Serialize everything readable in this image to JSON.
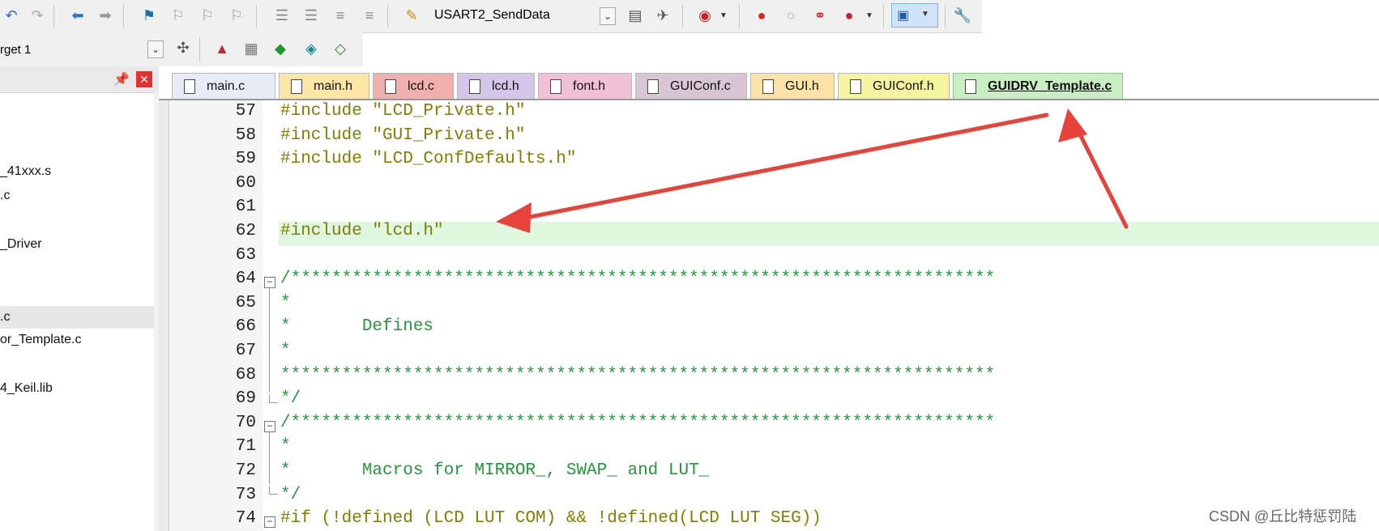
{
  "toolbar": {
    "target_function": "USART2_SendData",
    "build_target": "rget 1"
  },
  "project_panel": {
    "items": [
      "_41xxx.s",
      ".c",
      "_Driver",
      ".c",
      "or_Template.c",
      "4_Keil.lib"
    ]
  },
  "tabs": [
    {
      "label": "main.c",
      "color": "#e8ecf7"
    },
    {
      "label": "main.h",
      "color": "#fbe6a6"
    },
    {
      "label": "lcd.c",
      "color": "#f1b0ae"
    },
    {
      "label": "lcd.h",
      "color": "#d4c6e8"
    },
    {
      "label": "font.h",
      "color": "#f3c1d6"
    },
    {
      "label": "GUIConf.c",
      "color": "#d8c7d2"
    },
    {
      "label": "GUI.h",
      "color": "#fbe3a8"
    },
    {
      "label": "GUIConf.h",
      "color": "#f5f5a0"
    },
    {
      "label": "GUIDRV_Template.c",
      "color": "#c9eec3"
    }
  ],
  "code_lines": [
    {
      "num": "57",
      "text": "#include \"LCD_Private.h\""
    },
    {
      "num": "58",
      "text": "#include \"GUI_Private.h\""
    },
    {
      "num": "59",
      "text": "#include \"LCD_ConfDefaults.h\""
    },
    {
      "num": "60",
      "text": ""
    },
    {
      "num": "61",
      "text": ""
    },
    {
      "num": "62",
      "text": "#include \"lcd.h\""
    },
    {
      "num": "63",
      "text": ""
    },
    {
      "num": "64",
      "text": "/*********************************************************************"
    },
    {
      "num": "65",
      "text": "*"
    },
    {
      "num": "66",
      "text": "*       Defines"
    },
    {
      "num": "67",
      "text": "*"
    },
    {
      "num": "68",
      "text": "**********************************************************************"
    },
    {
      "num": "69",
      "text": "*/"
    },
    {
      "num": "70",
      "text": "/*********************************************************************"
    },
    {
      "num": "71",
      "text": "*"
    },
    {
      "num": "72",
      "text": "*       Macros for MIRROR_, SWAP_ and LUT_"
    },
    {
      "num": "73",
      "text": "*/"
    },
    {
      "num": "74",
      "text": "#if (!defined (LCD LUT COM) && !defined(LCD LUT SEG))"
    }
  ],
  "colors": {
    "preprocessor": "#808000",
    "string": "#4a4a4a",
    "comment": "#1f9a3a",
    "line_highlight": "#dff7df",
    "annotation_arrow": "#e8433a"
  },
  "watermark": "CSDN @丘比特惩罚陆"
}
